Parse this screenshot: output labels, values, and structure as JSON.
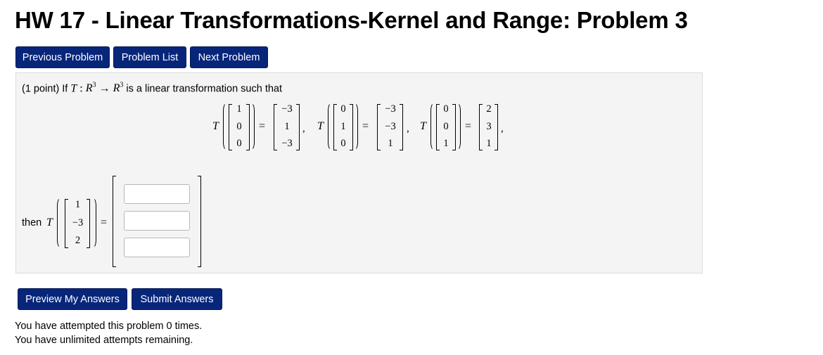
{
  "title": "HW 17 - Linear Transformations-Kernel and Range: Problem 3",
  "nav": {
    "previous": "Previous Problem",
    "list": "Problem List",
    "next": "Next Problem"
  },
  "problem": {
    "points": "(1 point) If",
    "T": "T",
    "colon": ":",
    "R": "R",
    "exp": "3",
    "arrow": "→",
    "suffix": "is a linear transformation such that",
    "then": "then",
    "eq": "=",
    "comma": ",",
    "e1": [
      "1",
      "0",
      "0"
    ],
    "img1": [
      "−3",
      "1",
      "−3"
    ],
    "e2": [
      "0",
      "1",
      "0"
    ],
    "img2": [
      "−3",
      "−3",
      "1"
    ],
    "e3": [
      "0",
      "0",
      "1"
    ],
    "img3": [
      "2",
      "3",
      "1"
    ],
    "query": [
      "1",
      "−3",
      "2"
    ],
    "answers": [
      "",
      "",
      ""
    ]
  },
  "actions": {
    "preview": "Preview My Answers",
    "submit": "Submit Answers"
  },
  "status": {
    "attempted": "You have attempted this problem 0 times.",
    "remaining": "You have unlimited attempts remaining."
  }
}
